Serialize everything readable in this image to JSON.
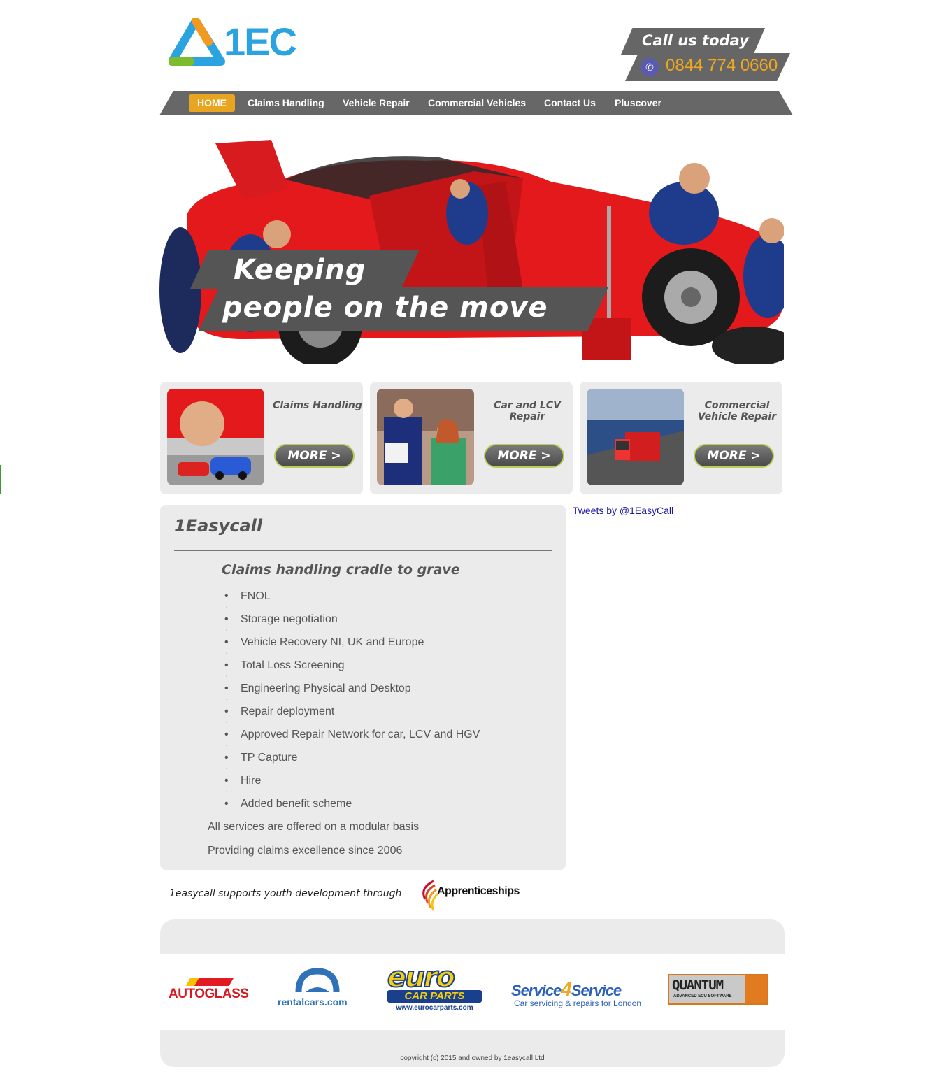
{
  "header": {
    "logo_text": "1EC",
    "call_label": "Call us today",
    "phone": "0844 774 0660"
  },
  "nav": {
    "items": [
      {
        "label": "HOME",
        "active": true
      },
      {
        "label": "Claims Handling",
        "active": false
      },
      {
        "label": "Vehicle Repair",
        "active": false
      },
      {
        "label": "Commercial Vehicles",
        "active": false
      },
      {
        "label": "Contact Us",
        "active": false
      },
      {
        "label": "Pluscover",
        "active": false
      }
    ]
  },
  "hero": {
    "line1": "Keeping",
    "line2": "people on the move"
  },
  "cards": [
    {
      "title": "Claims Handling",
      "button": "MORE >"
    },
    {
      "title": "Car and LCV Repair",
      "button": "MORE >"
    },
    {
      "title": "Commercial Vehicle Repair",
      "button": "MORE >"
    }
  ],
  "content": {
    "title": "1Easycall",
    "subtitle": "Claims handling cradle to grave",
    "bullets": [
      "FNOL",
      "Storage negotiation",
      "Vehicle Recovery NI, UK and Europe",
      "Total Loss Screening",
      "Engineering Physical and Desktop",
      "Repair deployment",
      "Approved Repair Network for car, LCV and HGV",
      "TP Capture",
      "Hire",
      "Added benefit scheme"
    ],
    "para1": "All services are offered on a modular basis",
    "para2": "Providing claims excellence since 2006"
  },
  "tweets_link": "Tweets by @1EasyCall",
  "youth": {
    "text": "1easycall supports youth development through",
    "logo_text": "Apprenticeships"
  },
  "partners": {
    "autoglass": "AUTOGLASS",
    "rentalcars": "rentalcars.com",
    "euro_word": "euro",
    "euro_bar": "CAR PARTS",
    "euro_url": "www.eurocarparts.com",
    "s4s_a": "Service",
    "s4s_four": "4",
    "s4s_b": "Service",
    "s4s_sub": "Car servicing & repairs for London",
    "quantum": "QUANTUM",
    "quantum_sub": "ADVANCED ECU SOFTWARE"
  },
  "footer": {
    "copyright": "copyright (c) 2015 and owned by 1easycall Ltd"
  },
  "colors": {
    "accent": "#e8a522",
    "nav_bg": "#676767",
    "panel_bg": "#ebebeb",
    "phone": "#f0a81e",
    "car_red": "#e3191c"
  }
}
